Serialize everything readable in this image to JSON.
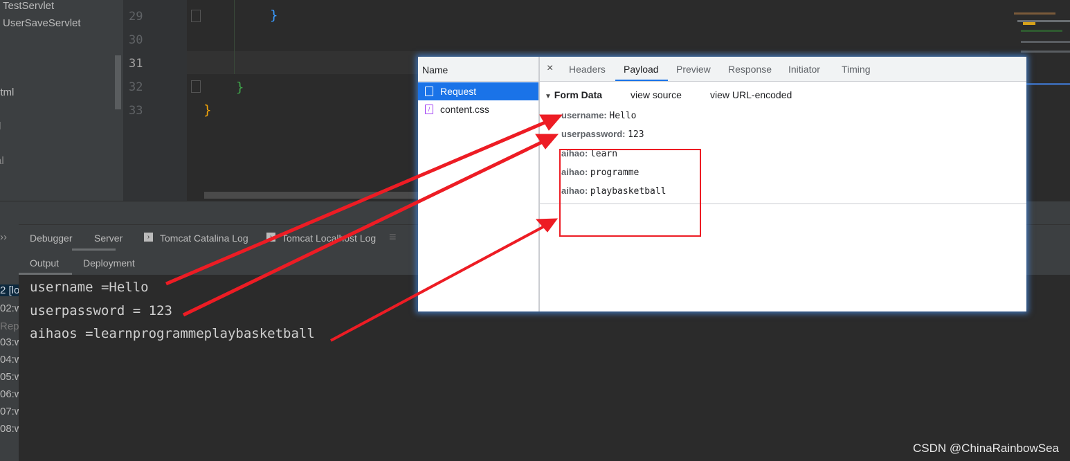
{
  "project_tree": {
    "items": [
      "TestServlet",
      "UserSaveServlet",
      "ntml",
      "l",
      "l",
      "al"
    ]
  },
  "editor": {
    "line_numbers": [
      "29",
      "30",
      "31",
      "32",
      "33"
    ],
    "braces": [
      "}",
      "}",
      "}"
    ]
  },
  "bottom_panel": {
    "tabs": [
      "Debugger",
      "Server",
      "Tomcat Catalina Log",
      "Tomcat Localhost Log"
    ],
    "active_tab": "Server",
    "subtabs": [
      "Output",
      "Deployment"
    ],
    "active_subtab": "Output",
    "left_strip": [
      "2 [lo",
      "02:w",
      "Rep",
      "03:w",
      "04:w",
      "05:w",
      "06:w",
      "07:w",
      "08:w"
    ],
    "output_lines": [
      "username =Hello",
      "userpassword = 123",
      "aihaos =learnprogrammeplaybasketball"
    ]
  },
  "devtools": {
    "name_header": "Name",
    "requests": [
      {
        "name": "Request",
        "icon": "document-icon",
        "selected": true
      },
      {
        "name": "content.css",
        "icon": "css-file-icon",
        "selected": false
      }
    ],
    "close": "×",
    "tabs": [
      "Headers",
      "Payload",
      "Preview",
      "Response",
      "Initiator",
      "Timing"
    ],
    "active_tab": "Payload",
    "form_data": {
      "title": "Form Data",
      "view_source": "view source",
      "view_url_encoded": "view URL-encoded",
      "fields": [
        {
          "key": "username:",
          "value": "Hello"
        },
        {
          "key": "userpassword:",
          "value": "123"
        },
        {
          "key": "aihao:",
          "value": "learn"
        },
        {
          "key": "aihao:",
          "value": "programme"
        },
        {
          "key": "aihao:",
          "value": "playbasketball"
        }
      ]
    }
  },
  "annotation_color": "#ed1c24",
  "watermark": "CSDN @ChinaRainbowSea"
}
